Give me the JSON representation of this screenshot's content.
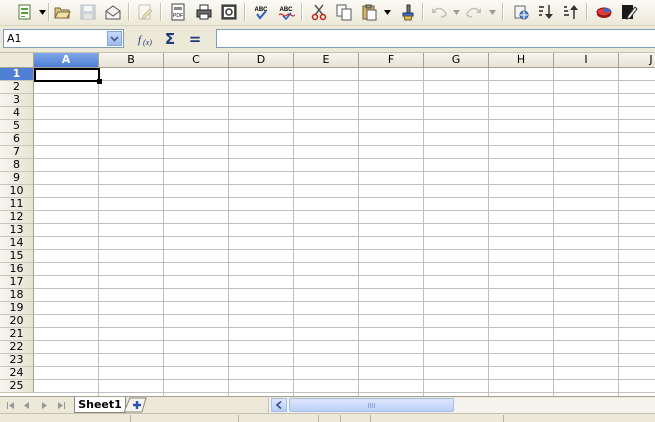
{
  "toolbar": {
    "items": [
      {
        "name": "new-document-icon"
      },
      {
        "name": "open-folder-icon"
      },
      {
        "name": "save-icon",
        "disabled": true
      },
      {
        "name": "email-icon"
      },
      {
        "name": "edit-file-icon",
        "disabled": true
      },
      {
        "name": "export-pdf-icon"
      },
      {
        "name": "print-icon"
      },
      {
        "name": "print-preview-icon"
      },
      {
        "name": "spellcheck-icon"
      },
      {
        "name": "autospellcheck-icon"
      },
      {
        "name": "cut-icon"
      },
      {
        "name": "copy-icon"
      },
      {
        "name": "paste-icon"
      },
      {
        "name": "format-paintbrush-icon"
      },
      {
        "name": "undo-icon",
        "disabled": true
      },
      {
        "name": "redo-icon",
        "disabled": true
      },
      {
        "name": "hyperlink-icon"
      },
      {
        "name": "sort-ascending-icon"
      },
      {
        "name": "sort-descending-icon"
      },
      {
        "name": "insert-chart-icon"
      },
      {
        "name": "show-draw-functions-icon"
      }
    ]
  },
  "formula_bar": {
    "name_box": "A1",
    "formula": "",
    "buttons": [
      {
        "name": "function-wizard-icon"
      },
      {
        "name": "sum-icon",
        "glyph": "Σ"
      },
      {
        "name": "function-equals-icon",
        "glyph": "="
      }
    ]
  },
  "grid": {
    "columns": [
      "A",
      "B",
      "C",
      "D",
      "E",
      "F",
      "G",
      "H",
      "I",
      "J"
    ],
    "rows": [
      "1",
      "2",
      "3",
      "4",
      "5",
      "6",
      "7",
      "8",
      "9",
      "10",
      "11",
      "12",
      "13",
      "14",
      "15",
      "16",
      "17",
      "18",
      "19",
      "20",
      "21",
      "22",
      "23",
      "24",
      "25"
    ],
    "selected_cell": "A1",
    "selected_column": "A",
    "selected_row": "1"
  },
  "sheets": {
    "tabs": [
      "Sheet1"
    ],
    "active": "Sheet1"
  },
  "colors": {
    "selection_header": "#4e7fd4",
    "gridline": "#c0c0c0",
    "chrome": "#ece9d8"
  }
}
